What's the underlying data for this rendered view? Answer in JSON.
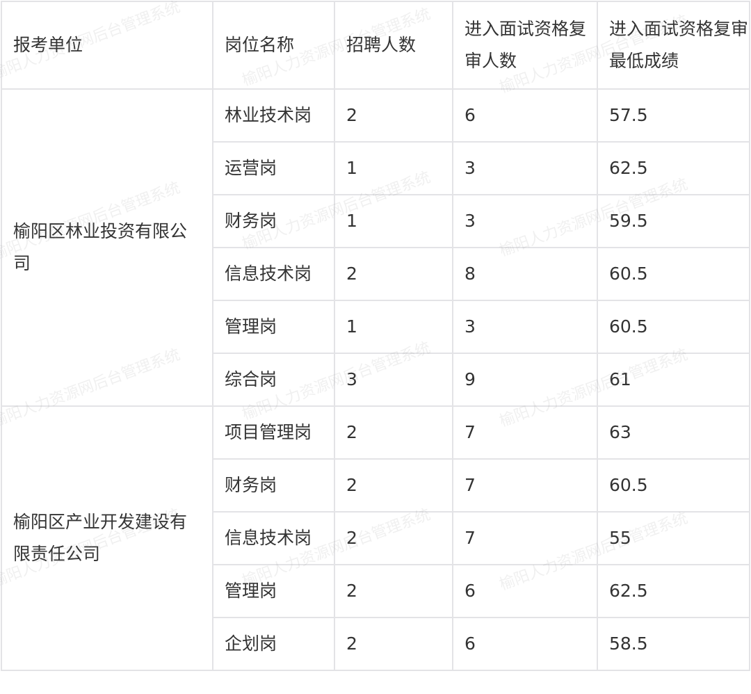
{
  "header": {
    "unit": "报考单位",
    "position": "岗位名称",
    "hires": "招聘人数",
    "review_count": "进入面试资格复审人数",
    "min_score": "进入面试资格复审最低成绩"
  },
  "watermark_text": "榆阳人力资源网后台管理系统",
  "groups": [
    {
      "unit": "榆阳区林业投资有限公司",
      "rows": [
        {
          "position": "林业技术岗",
          "hires": "2",
          "review_count": "6",
          "min_score": "57.5"
        },
        {
          "position": "运营岗",
          "hires": "1",
          "review_count": "3",
          "min_score": "62.5"
        },
        {
          "position": "财务岗",
          "hires": "1",
          "review_count": "3",
          "min_score": "59.5"
        },
        {
          "position": "信息技术岗",
          "hires": "2",
          "review_count": "8",
          "min_score": "60.5"
        },
        {
          "position": "管理岗",
          "hires": "1",
          "review_count": "3",
          "min_score": "60.5"
        },
        {
          "position": "综合岗",
          "hires": "3",
          "review_count": "9",
          "min_score": "61"
        }
      ]
    },
    {
      "unit": "榆阳区产业开发建设有限责任公司",
      "rows": [
        {
          "position": "项目管理岗",
          "hires": "2",
          "review_count": "7",
          "min_score": "63"
        },
        {
          "position": "财务岗",
          "hires": "2",
          "review_count": "7",
          "min_score": "60.5"
        },
        {
          "position": "信息技术岗",
          "hires": "2",
          "review_count": "7",
          "min_score": "55"
        },
        {
          "position": "管理岗",
          "hires": "2",
          "review_count": "6",
          "min_score": "62.5"
        },
        {
          "position": "企划岗",
          "hires": "2",
          "review_count": "6",
          "min_score": "58.5"
        }
      ]
    }
  ]
}
